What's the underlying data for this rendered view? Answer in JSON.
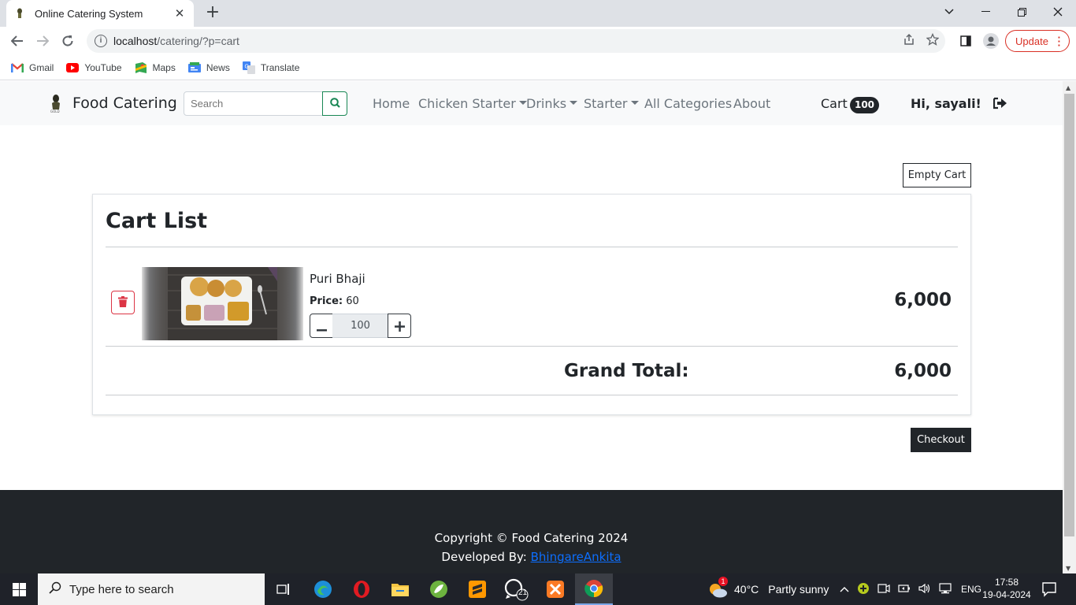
{
  "browser": {
    "tab_title": "Online Catering System",
    "url_host": "localhost",
    "url_path": "/catering/?p=cart",
    "update_label": "Update",
    "bookmarks": [
      {
        "label": "Gmail",
        "icon": "gmail-icon"
      },
      {
        "label": "YouTube",
        "icon": "youtube-icon"
      },
      {
        "label": "Maps",
        "icon": "maps-icon"
      },
      {
        "label": "News",
        "icon": "news-icon"
      },
      {
        "label": "Translate",
        "icon": "translate-icon"
      }
    ]
  },
  "navbar": {
    "brand": "Food Catering",
    "search_placeholder": "Search",
    "links": {
      "home": "Home",
      "chicken_starter": "Chicken Starter",
      "drinks": "Drinks",
      "starter": "Starter",
      "all_categories": "All Categories",
      "about": "About"
    },
    "cart_label": "Cart",
    "cart_count": "100",
    "greeting": "Hi, sayali!"
  },
  "cart": {
    "empty_cart_label": "Empty Cart",
    "title": "Cart List",
    "items": [
      {
        "name": "Puri Bhaji",
        "price_label": "Price:",
        "price": "60",
        "quantity": "100",
        "total": "6,000"
      }
    ],
    "grand_total_label": "Grand Total:",
    "grand_total": "6,000",
    "checkout_label": "Checkout"
  },
  "footer": {
    "copyright": "Copyright © Food Catering 2024",
    "developed_by_label": "Developed By:",
    "developer": "BhingareAnkita"
  },
  "taskbar": {
    "search_placeholder": "Type here to search",
    "whatsapp_badge": "21",
    "weather_badge": "1",
    "temperature": "40°C",
    "weather_text": "Partly sunny",
    "language": "ENG",
    "time": "17:58",
    "date": "19-04-2024"
  },
  "colors": {
    "accent_success": "#198754",
    "danger": "#dc3545",
    "dark": "#212529",
    "link": "#0d6efd"
  }
}
